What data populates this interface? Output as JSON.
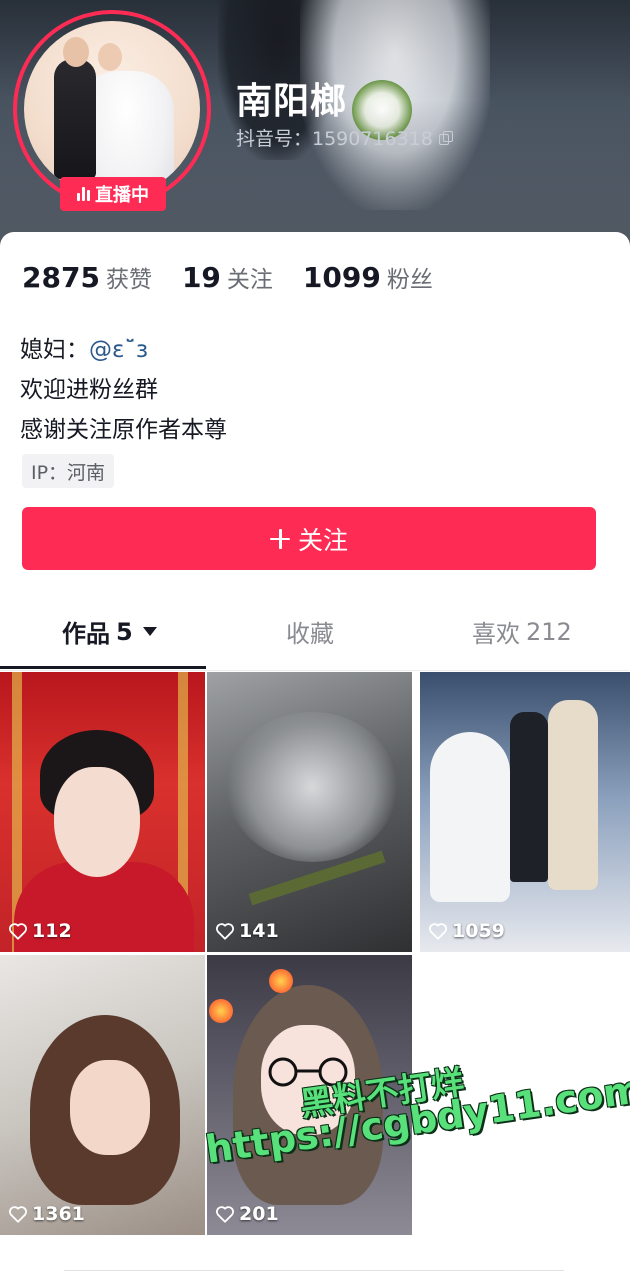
{
  "profile": {
    "nickname": "南阳榔",
    "douyin_id": "抖音号：1590716318",
    "live_label": "直播中",
    "stats": {
      "likes_num": "2875",
      "likes_label": "获赞",
      "following_num": "19",
      "following_label": "关注",
      "followers_num": "1099",
      "followers_label": "粉丝"
    },
    "bio": {
      "line1_prefix": "媳妇：",
      "line1_mention": "@ɛ˘̈ɜ",
      "line2": "欢迎进粉丝群",
      "line3": "感谢关注原作者本尊"
    },
    "ip_tag": "IP：河南",
    "follow_button": "关注"
  },
  "tabs": {
    "works_label": "作品",
    "works_count": "5",
    "favorites_label": "收藏",
    "liked_label": "喜欢",
    "liked_count": "212"
  },
  "videos": [
    {
      "likes": "112"
    },
    {
      "likes": "141"
    },
    {
      "likes": "1059"
    },
    {
      "likes": "1361"
    },
    {
      "likes": "201"
    }
  ],
  "watermark": {
    "line1": "黑料不打烊",
    "line2": "https://cgbdy11.com"
  },
  "colors": {
    "accent": "#fe2c55",
    "watermark_green": "#58e07a"
  }
}
